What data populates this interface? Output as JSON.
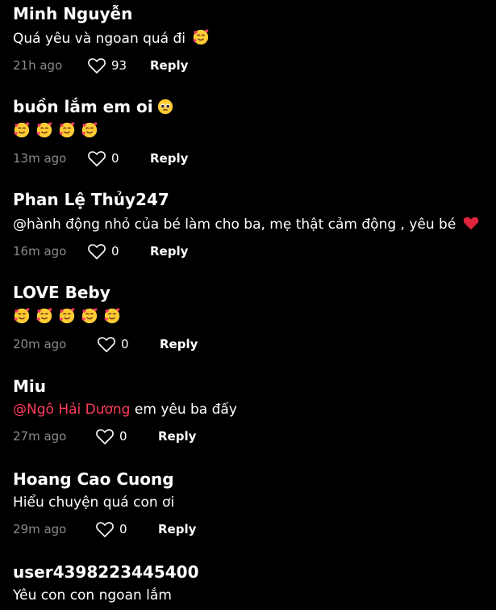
{
  "colors": {
    "background": "#000000",
    "text": "#ffffff",
    "muted": "#8a8a8a",
    "mention": "#ff3b5c",
    "heart_red": "#e0243b"
  },
  "reply_label": "Reply",
  "comments": [
    {
      "username": "Minh Nguyễn",
      "text": "Quá yêu và ngoan quá đi",
      "emojis": [
        "smiling-face-with-hearts"
      ],
      "time": "21h ago",
      "likes": "93"
    },
    {
      "username": "buồn lắm em oi",
      "username_emoji": "pleading-face",
      "emojis": [
        "smiling-face-with-hearts",
        "smiling-face-with-hearts",
        "smiling-face-with-hearts",
        "smiling-face-with-hearts"
      ],
      "time": "13m ago",
      "likes": "0"
    },
    {
      "username": "Phan Lệ Thủy247",
      "text": "@hành động nhỏ của bé làm cho ba, mẹ thật cảm động , yêu bé",
      "emojis": [
        "red-heart"
      ],
      "time": "16m ago",
      "likes": "0"
    },
    {
      "username": "LOVE Beby",
      "emojis": [
        "smiling-face-with-hearts",
        "smiling-face-with-hearts",
        "smiling-face-with-hearts",
        "smiling-face-with-hearts",
        "smiling-face-with-hearts"
      ],
      "time": "20m ago",
      "likes": "0"
    },
    {
      "username": "Miu",
      "mention": "@Ngô Hải Dương",
      "text": "em yêu ba đấy",
      "time": "27m ago",
      "likes": "0"
    },
    {
      "username": "Hoang Cao Cuong",
      "text": "Hiểu chuyện quá con ơi",
      "time": "29m ago",
      "likes": "0"
    },
    {
      "username": "user4398223445400",
      "text": "Yêu con con ngoan lắm"
    }
  ]
}
